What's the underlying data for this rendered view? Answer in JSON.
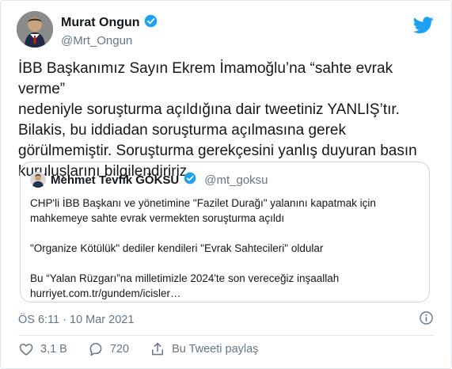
{
  "author": {
    "display_name": "Murat Ongun",
    "handle": "@Mrt_Ongun",
    "avatar_icon": "user-avatar",
    "verified_icon": "verified-badge-icon"
  },
  "tweet": {
    "text": "İBB Başkanımız Sayın Ekrem İmamoğlu’na “sahte evrak verme”\nnedeniyle soruşturma açıldığına dair tweetiniz YANLIŞ’tır.\nBilakis, bu iddiadan soruşturma açılmasına gerek\ngörülmemiştir. Soruşturma gerekçesini yanlış duyuran basın\nkuruluşlarını bilgilendiririz.",
    "timestamp": "ÖS 6:11 · 10 Mar 2021"
  },
  "quoted": {
    "display_name": "Mehmet Tevfik GÖKSU",
    "handle": "@mt_goksu",
    "text": "CHP'li İBB Başkanı ve yönetimine \"Fazilet Durağı\" yalanını kapatmak için\nmahkemeye sahte evrak vermekten soruşturma açıldı\n\n\"Organize Kötülük\" dediler kendileri \"Evrak Sahtecileri\" oldular\n\nBu “Yalan Rüzgarı”na milletimizle 2024'te son vereceğiz inşaallah\nhurriyet.com.tr/gundem/icisler…"
  },
  "actions": {
    "like_count": "3,1 B",
    "reply_count": "720",
    "share_label": "Bu Tweeti paylaş"
  },
  "icons": {
    "brand": "twitter-bird-icon",
    "info": "info-icon",
    "like": "heart-icon",
    "reply": "reply-bubble-icon",
    "share": "share-icon"
  },
  "colors": {
    "twitter_blue": "#1da1f2",
    "secondary_text": "#657786",
    "border": "#e1e8ed"
  }
}
